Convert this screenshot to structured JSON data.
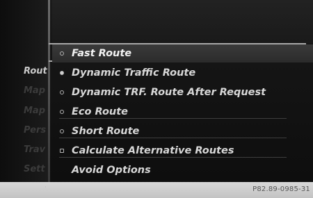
{
  "left_menu": [
    {
      "label": "Rout",
      "active": true
    },
    {
      "label": "Map",
      "active": false
    },
    {
      "label": "Map",
      "active": false
    },
    {
      "label": "Pers",
      "active": false
    },
    {
      "label": "Trav",
      "active": false
    },
    {
      "label": "Sett",
      "active": false
    }
  ],
  "route_options": [
    {
      "label": "Fast Route",
      "state": "unchecked"
    },
    {
      "label": "Dynamic Traffic Route",
      "state": "checked"
    },
    {
      "label": "Dynamic TRF. Route After Request",
      "state": "unchecked"
    },
    {
      "label": "Eco Route",
      "state": "unchecked"
    },
    {
      "label": "Short Route",
      "state": "unchecked"
    },
    {
      "label": "Calculate Alternative Routes",
      "state": "unchecked"
    },
    {
      "label": "Avoid Options",
      "state": "none"
    }
  ],
  "footer": {
    "code": "P82.89-0985-31"
  },
  "colors": {
    "screen_bg": "#161616",
    "text": "#d8d8d8",
    "selection": "#3a3a3a"
  }
}
